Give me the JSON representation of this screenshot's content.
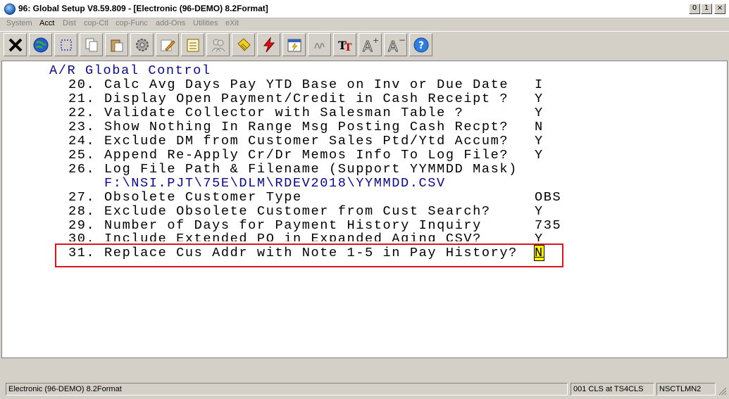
{
  "window": {
    "title": "96: Global Setup V8.59.809 - [Electronic (96-DEMO) 8.2Format]",
    "buttons": {
      "minimize": "0",
      "maximize": "1",
      "close": "×"
    }
  },
  "menu": {
    "items": [
      "System",
      "Acct",
      "Dist",
      "cop-Ctl",
      "cop-Func",
      "add-Ons",
      "Utilities",
      "eXit"
    ],
    "active": "Acct"
  },
  "toolbar": {
    "icons": [
      "close-x-icon",
      "globe-icon",
      "select-rect-icon",
      "copy-icon",
      "paste-icon",
      "gear-icon",
      "edit-pencil-icon",
      "notes-icon",
      "people-icon",
      "tag-icon",
      "lightning-icon",
      "calendar-icon",
      "signature-icon",
      "font-tt-icon",
      "font-increase-icon",
      "font-decrease-icon",
      "help-icon"
    ]
  },
  "screen": {
    "heading": "A/R Global Control",
    "rows": [
      {
        "num": "20.",
        "label": "Calc Avg Days Pay YTD Base on Inv or Due Date",
        "value": "I"
      },
      {
        "num": "21.",
        "label": "Display Open Payment/Credit in Cash Receipt ?",
        "value": "Y"
      },
      {
        "num": "22.",
        "label": "Validate Collector with Salesman Table ?",
        "value": "Y"
      },
      {
        "num": "23.",
        "label": "Show Nothing In Range Msg Posting Cash Recpt?",
        "value": "N"
      },
      {
        "num": "24.",
        "label": "Exclude DM from Customer Sales Ptd/Ytd Accum?",
        "value": "Y"
      },
      {
        "num": "25.",
        "label": "Append Re-Apply Cr/Dr Memos Info To Log File?",
        "value": "Y"
      },
      {
        "num": "26.",
        "label": "Log File Path & Filename (Support YYMMDD Mask)",
        "value": ""
      },
      {
        "num": "27.",
        "label": "Obsolete Customer Type",
        "value": "OBS"
      },
      {
        "num": "28.",
        "label": "Exclude Obsolete Customer from Cust Search?",
        "value": "Y"
      },
      {
        "num": "29.",
        "label": "Number of Days for Payment History Inquiry",
        "value": "735"
      },
      {
        "num": "30.",
        "label": "Include Extended PO in Expanded Aging CSV?",
        "value": "Y"
      },
      {
        "num": "31.",
        "label": "Replace Cus Addr with Note 1-5 in Pay History?",
        "value": "N"
      }
    ],
    "log_path": "F:\\NSI.PJT\\75E\\DLM\\RDEV2018\\YYMMDD.CSV"
  },
  "status": {
    "left": "Electronic (96-DEMO) 8.2Format",
    "middle": "001 CLS at TS4CLS",
    "right": "NSCTLMN2"
  },
  "colors": {
    "value_blue": "#0a0a8c",
    "highlight_red": "#e0141c",
    "cursor_yellow": "#ffff00"
  }
}
